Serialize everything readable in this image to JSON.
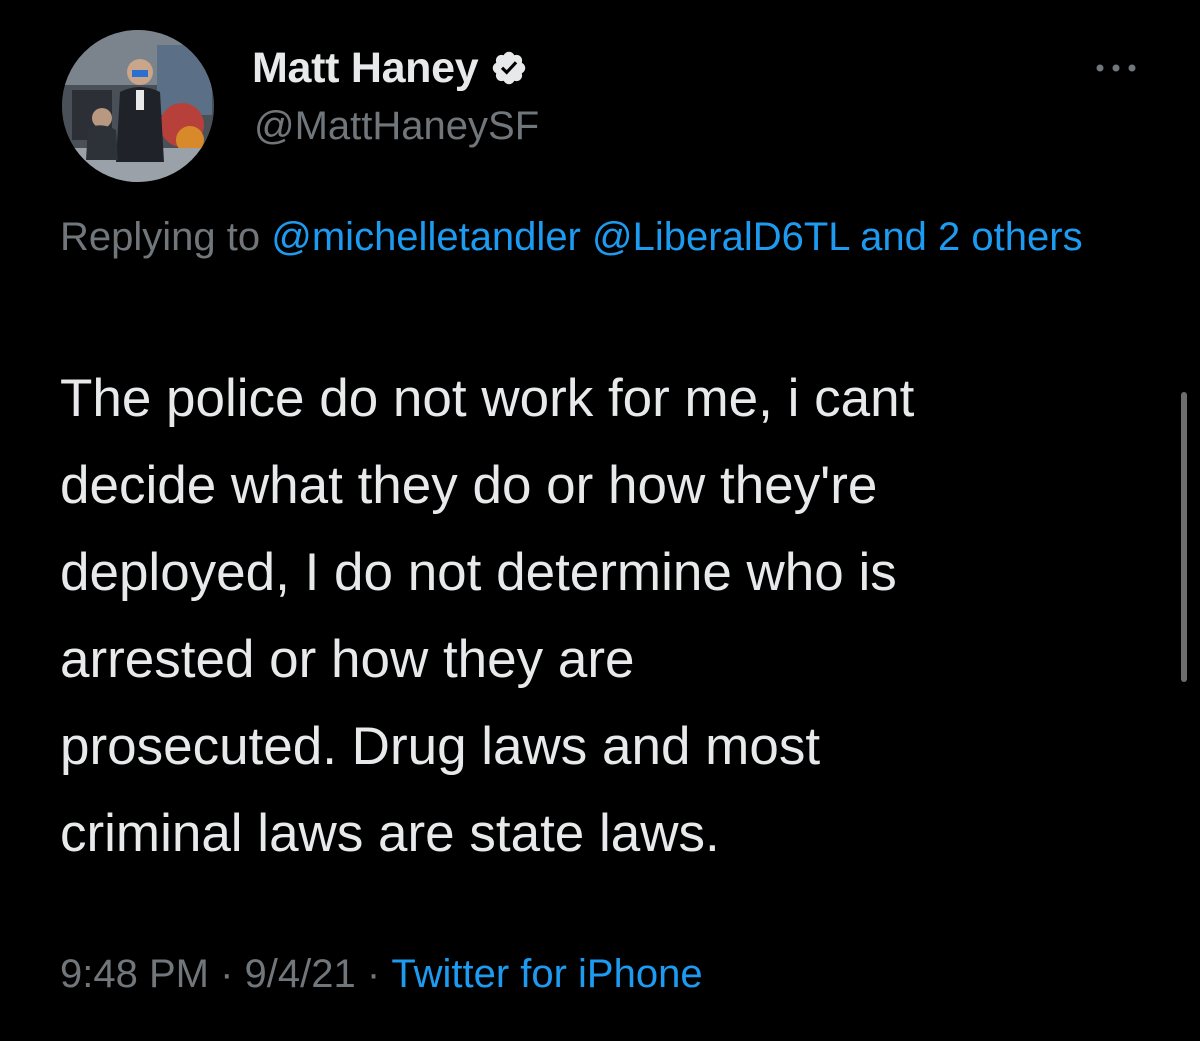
{
  "author": {
    "name": "Matt Haney",
    "handle": "@MattHaneySF",
    "verified_icon": "verified-badge-icon"
  },
  "reply": {
    "prefix": "Replying to",
    "mention_1": "@michelletandler",
    "mention_2": "@LiberalD6TL",
    "conjunction": "and",
    "others": "2 others"
  },
  "tweet": {
    "text": "The police do not work for me, i cant\ndecide what they do or how they're\ndeployed, I do not determine who is\narrested or how they are\nprosecuted.  Drug laws and most\ncriminal laws are state laws."
  },
  "meta": {
    "time": "9:48 PM",
    "separator": "·",
    "date": "9/4/21",
    "source": "Twitter for iPhone"
  },
  "colors": {
    "background": "#000000",
    "text_primary": "#e7e9ea",
    "text_secondary": "#71767b",
    "link": "#1d9bf0"
  }
}
